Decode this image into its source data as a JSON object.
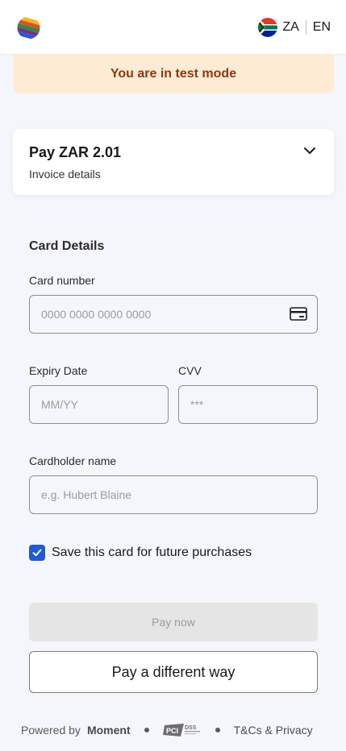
{
  "header": {
    "country_code": "ZA",
    "language": "EN"
  },
  "banner": {
    "text": "You are in test mode"
  },
  "summary": {
    "amount": "Pay ZAR 2.01",
    "details_label": "Invoice details"
  },
  "card_form": {
    "section_title": "Card Details",
    "card_number_label": "Card number",
    "card_number_placeholder": "0000 0000 0000 0000",
    "card_number_value": "",
    "expiry_label": "Expiry Date",
    "expiry_placeholder": "MM/YY",
    "expiry_value": "",
    "cvv_label": "CVV",
    "cvv_placeholder": "***",
    "cvv_value": "",
    "cardholder_label": "Cardholder name",
    "cardholder_placeholder": "e.g. Hubert Blaine",
    "cardholder_value": "",
    "save_card_label": "Save this card for future purchases",
    "save_card_checked": true
  },
  "actions": {
    "pay_now_label": "Pay now",
    "pay_different_label": "Pay a different way"
  },
  "footer": {
    "powered_by": "Powered by",
    "brand": "Moment",
    "pci_text": "PCI DSS",
    "terms": "T&Cs & Privacy"
  },
  "colors": {
    "accent": "#1e5bd8",
    "banner_bg": "#fdebd3",
    "banner_text": "#8a3a10",
    "page_bg": "#f5f6fb"
  },
  "icons": [
    "brand-logo-icon",
    "south-africa-flag-icon",
    "chevron-down-icon",
    "credit-card-icon",
    "checkmark-icon",
    "pci-dss-logo-icon"
  ]
}
